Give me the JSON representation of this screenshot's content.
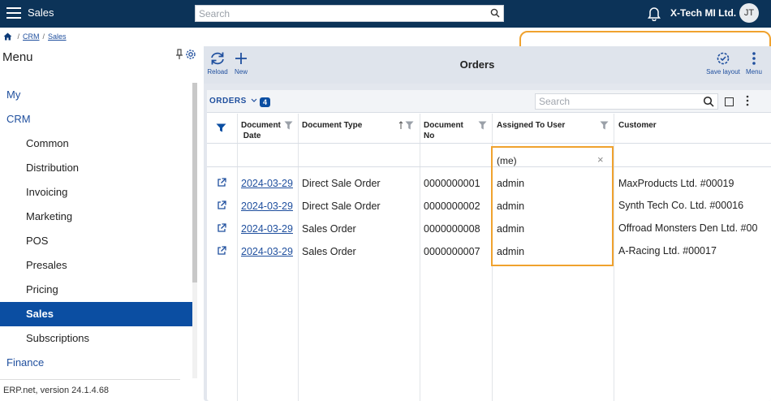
{
  "topbar": {
    "app_title": "Sales",
    "search_placeholder": "Search",
    "company": "X-Tech MI Ltd.",
    "user_initials": "JT"
  },
  "breadcrumb": {
    "items": [
      "CRM",
      "Sales"
    ]
  },
  "sidebar": {
    "title": "Menu",
    "items": [
      {
        "label": "My",
        "level": 0
      },
      {
        "label": "CRM",
        "level": 0
      },
      {
        "label": "Common",
        "level": 1
      },
      {
        "label": "Distribution",
        "level": 1
      },
      {
        "label": "Invoicing",
        "level": 1
      },
      {
        "label": "Marketing",
        "level": 1
      },
      {
        "label": "POS",
        "level": 1
      },
      {
        "label": "Presales",
        "level": 1
      },
      {
        "label": "Pricing",
        "level": 1
      },
      {
        "label": "Sales",
        "level": 1,
        "active": true
      },
      {
        "label": "Subscriptions",
        "level": 1
      },
      {
        "label": "Finance",
        "level": 0
      }
    ],
    "version": "ERP.net, version 24.1.4.68"
  },
  "toolbar": {
    "reload_label": "Reload",
    "new_label": "New",
    "title": "Orders",
    "save_layout_label": "Save layout",
    "menu_label": "Menu"
  },
  "grid": {
    "section_label": "ORDERS",
    "count": "4",
    "search_placeholder": "Search",
    "columns": {
      "date_line1": "Document",
      "date_line2": "Date",
      "type": "Document Type",
      "no_line1": "Document",
      "no_line2": "No",
      "assigned": "Assigned To User",
      "customer": "Customer"
    },
    "filter_assigned": "(me)",
    "rows": [
      {
        "date": "2024-03-29",
        "type": "Direct Sale Order",
        "no": "0000000001",
        "assigned": "admin",
        "customer": "MaxProducts Ltd. #00019"
      },
      {
        "date": "2024-03-29",
        "type": "Direct Sale Order",
        "no": "0000000002",
        "assigned": "admin",
        "customer": "Synth Tech Co. Ltd. #00016"
      },
      {
        "date": "2024-03-29",
        "type": "Sales Order",
        "no": "0000000008",
        "assigned": "admin",
        "customer": "Offroad Monsters Den Ltd. #00"
      },
      {
        "date": "2024-03-29",
        "type": "Sales Order",
        "no": "0000000007",
        "assigned": "admin",
        "customer": "A-Racing Ltd. #00017"
      }
    ]
  },
  "colors": {
    "topbar": "#0c3358",
    "accent": "#0b4ea2",
    "highlight": "#f0a22e"
  }
}
